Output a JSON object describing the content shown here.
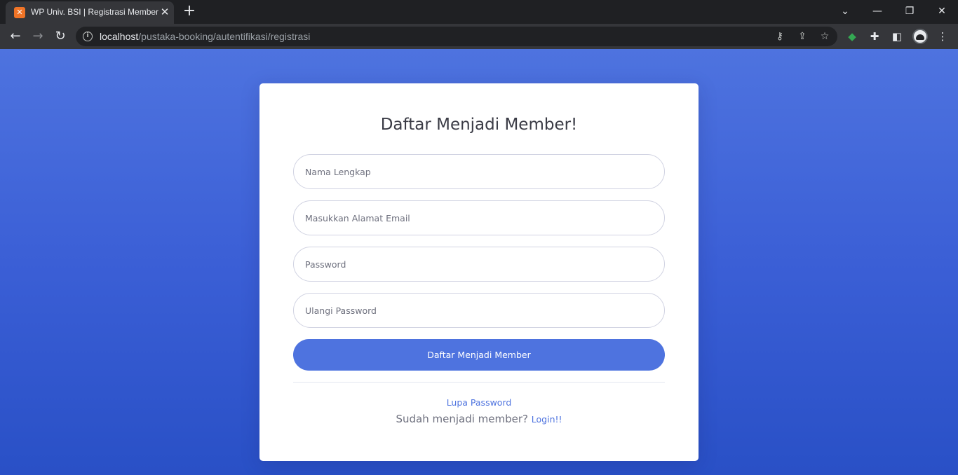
{
  "browser": {
    "tab": {
      "title": "WP Univ. BSI | Registrasi Member",
      "favicon": "xampp-icon"
    },
    "url": {
      "host": "localhost",
      "path": "/pustaka-booking/autentifikasi/registrasi"
    }
  },
  "form": {
    "title": "Daftar Menjadi Member!",
    "fields": {
      "nama_placeholder": "Nama Lengkap",
      "email_placeholder": "Masukkan Alamat Email",
      "password_placeholder": "Password",
      "password2_placeholder": "Ulangi Password"
    },
    "submit_label": "Daftar Menjadi Member",
    "forgot_label": "Lupa Password",
    "already_text": "Sudah menjadi member?",
    "login_label": "Login!!"
  },
  "colors": {
    "primary": "#4e73df",
    "background_gradient_top": "#4e73df",
    "background_gradient_bottom": "#2950c6",
    "card": "#ffffff"
  }
}
